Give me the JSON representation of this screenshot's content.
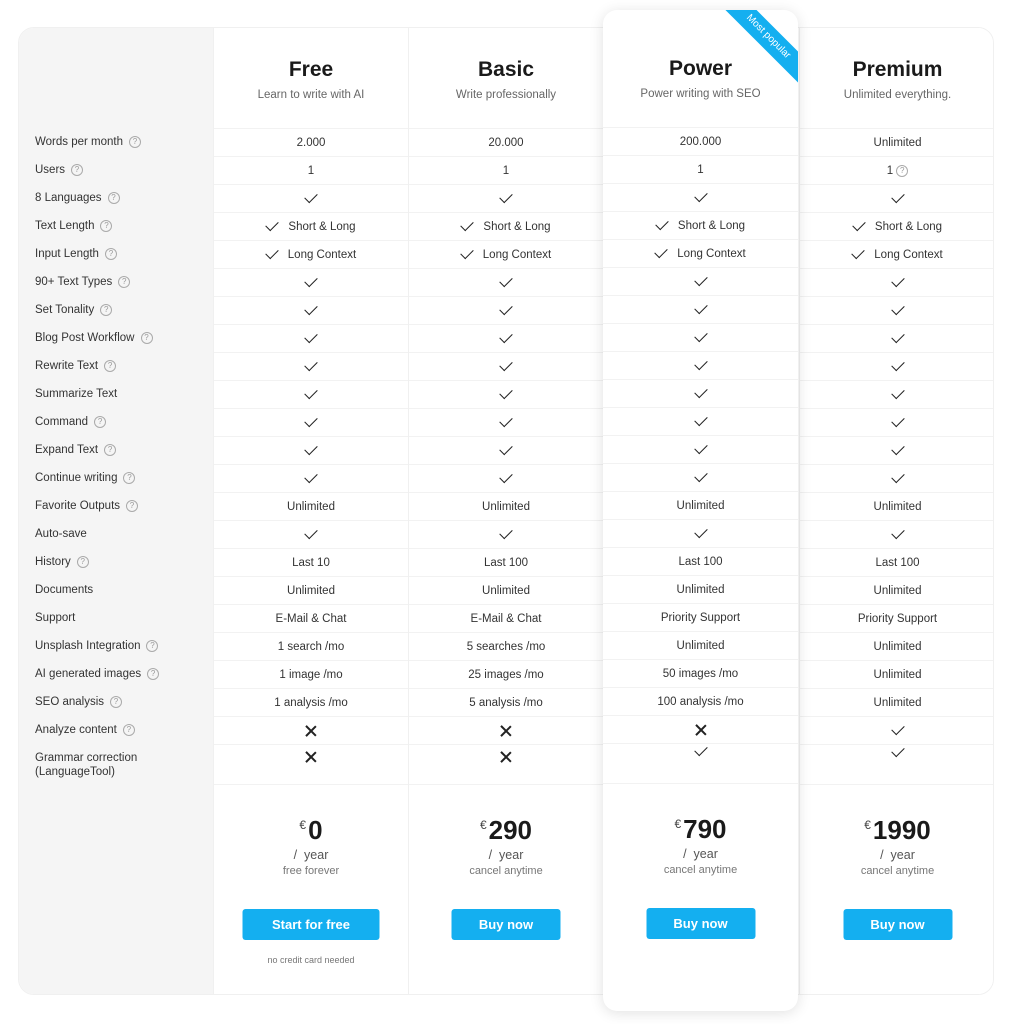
{
  "features": [
    {
      "label": "Words per month",
      "help": true
    },
    {
      "label": "Users",
      "help": true
    },
    {
      "label": "8 Languages",
      "help": true
    },
    {
      "label": "Text Length",
      "help": true
    },
    {
      "label": "Input Length",
      "help": true
    },
    {
      "label": "90+ Text Types",
      "help": true
    },
    {
      "label": "Set Tonality",
      "help": true
    },
    {
      "label": "Blog Post Workflow",
      "help": true
    },
    {
      "label": "Rewrite Text",
      "help": true
    },
    {
      "label": "Summarize Text",
      "help": false
    },
    {
      "label": "Command",
      "help": true
    },
    {
      "label": "Expand Text",
      "help": true
    },
    {
      "label": "Continue writing",
      "help": true
    },
    {
      "label": "Favorite Outputs",
      "help": true
    },
    {
      "label": "Auto-save",
      "help": false
    },
    {
      "label": "History",
      "help": true
    },
    {
      "label": "Documents",
      "help": false
    },
    {
      "label": "Support",
      "help": false
    },
    {
      "label": "Unsplash Integration",
      "help": true
    },
    {
      "label": "AI generated images",
      "help": true
    },
    {
      "label": "SEO analysis",
      "help": true
    },
    {
      "label": "Analyze content",
      "help": true
    },
    {
      "label": "Grammar correction (LanguageTool)",
      "help": false
    }
  ],
  "plans": [
    {
      "key": "free",
      "name": "Free",
      "subtitle": "Learn to write with AI",
      "values": [
        "2.000",
        "1",
        "check",
        "check:Short & Long",
        "check:Long Context",
        "check",
        "check",
        "check",
        "check",
        "check",
        "check",
        "check",
        "check",
        "Unlimited",
        "check",
        "Last 10",
        "Unlimited",
        "E-Mail & Chat",
        "1 search /mo",
        "1 image /mo",
        "1 analysis /mo",
        "cross",
        "cross"
      ],
      "currency": "€",
      "price": "0",
      "period": "/  year",
      "note": "free forever",
      "button": "Start for free",
      "fine_print": "no credit card needed"
    },
    {
      "key": "basic",
      "name": "Basic",
      "subtitle": "Write professionally",
      "values": [
        "20.000",
        "1",
        "check",
        "check:Short & Long",
        "check:Long Context",
        "check",
        "check",
        "check",
        "check",
        "check",
        "check",
        "check",
        "check",
        "Unlimited",
        "check",
        "Last 100",
        "Unlimited",
        "E-Mail & Chat",
        "5 searches /mo",
        "25 images /mo",
        "5 analysis /mo",
        "cross",
        "cross"
      ],
      "currency": "€",
      "price": "290",
      "period": "/  year",
      "note": "cancel anytime",
      "button": "Buy now"
    },
    {
      "key": "power",
      "name": "Power",
      "subtitle": "Power writing with SEO",
      "badge": "Most popular",
      "values": [
        "200.000",
        "1",
        "check",
        "check:Short & Long",
        "check:Long Context",
        "check",
        "check",
        "check",
        "check",
        "check",
        "check",
        "check",
        "check",
        "Unlimited",
        "check",
        "Last 100",
        "Unlimited",
        "Priority Support",
        "Unlimited",
        "50 images /mo",
        "100 analysis /mo",
        "cross",
        "check"
      ],
      "currency": "€",
      "price": "790",
      "period": "/  year",
      "note": "cancel anytime",
      "button": "Buy now"
    },
    {
      "key": "premium",
      "name": "Premium",
      "subtitle": "Unlimited everything.",
      "values": [
        "Unlimited",
        "1|help",
        "check",
        "check:Short & Long",
        "check:Long Context",
        "check",
        "check",
        "check",
        "check",
        "check",
        "check",
        "check",
        "check",
        "Unlimited",
        "check",
        "Last 100",
        "Unlimited",
        "Priority Support",
        "Unlimited",
        "Unlimited",
        "Unlimited",
        "check",
        "check"
      ],
      "currency": "€",
      "price": "1990",
      "period": "/  year",
      "note": "cancel anytime",
      "button": "Buy now"
    }
  ],
  "colors": {
    "accent": "#14aff0",
    "label_column_bg": "#f5f5f5",
    "text": "#222222"
  },
  "icons": {
    "help": "question-circle-icon",
    "check": "check-icon",
    "cross": "cross-icon"
  }
}
